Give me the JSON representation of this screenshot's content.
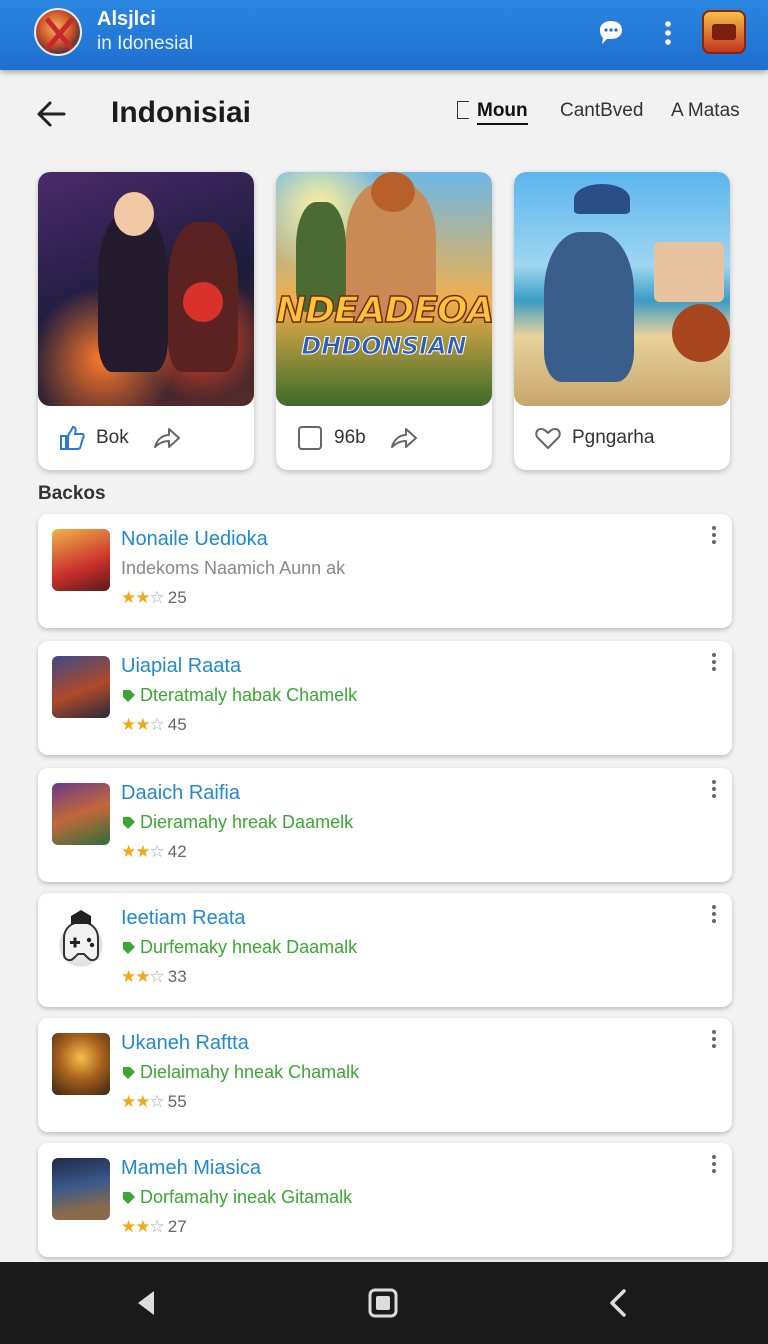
{
  "app": {
    "title": "Alsjlci",
    "subtitle": "in Idonesial"
  },
  "icons": {
    "chat": "chat-bubble-icon",
    "more": "more-vertical-icon",
    "badge": "treasure-chest-icon"
  },
  "header": {
    "title": "Indonisiai",
    "tabs": [
      {
        "label": "Moun",
        "active": true
      },
      {
        "label": "CantBved",
        "active": false
      },
      {
        "label": "A Matas",
        "active": false
      }
    ]
  },
  "featured": [
    {
      "label": "Bok",
      "icon": "thumbs-up-icon"
    },
    {
      "art_title": "NDEADEOA!",
      "art_subtitle": "DHDONSIAN",
      "label": "96b",
      "icon": "checkbox-icon"
    },
    {
      "label": "Pgngarha",
      "icon": "heart-icon"
    }
  ],
  "section": {
    "label": "Backos"
  },
  "list": [
    {
      "name": "Nonaile Uedioka",
      "desc": "Indekoms Naamich Aunn ak",
      "desc_style": "grey",
      "stars": 2,
      "count": "25"
    },
    {
      "name": "Uiapial Raata",
      "desc": "Dteratmaly habak Chamelk",
      "desc_style": "green",
      "stars": 2,
      "count": "45"
    },
    {
      "name": "Daaich Raifia",
      "desc": "Dieramahy hreak Daamelk",
      "desc_style": "green",
      "stars": 2,
      "count": "42"
    },
    {
      "name": "Ieetiam Reata",
      "desc": "Durfemaky hneak Daamalk",
      "desc_style": "green",
      "stars": 2,
      "count": "33"
    },
    {
      "name": "Ukaneh Raftta",
      "desc": "Dielaimahy hneak Chamalk",
      "desc_style": "green",
      "stars": 2,
      "count": "55"
    },
    {
      "name": "Mameh Miasica",
      "desc": "Dorfamahy ineak Gitamalk",
      "desc_style": "green",
      "stars": 2,
      "count": "27"
    }
  ],
  "colors": {
    "appbar": "#1f6fcf",
    "link": "#1e8ad0",
    "green": "#3aa832",
    "star": "#f2a818",
    "navbar": "#1a1a1a"
  }
}
